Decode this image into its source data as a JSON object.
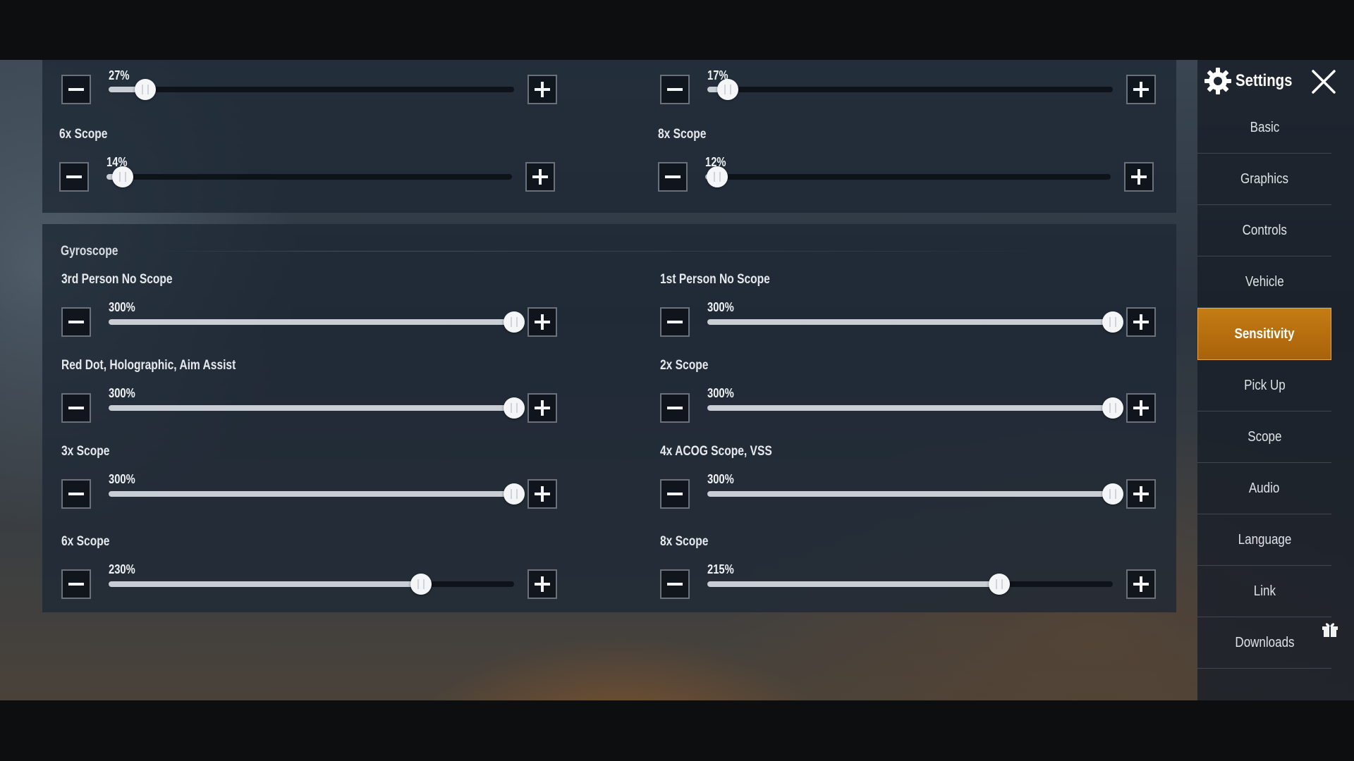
{
  "sidebar": {
    "title": "Settings",
    "items": [
      {
        "label": "Basic",
        "active": false
      },
      {
        "label": "Graphics",
        "active": false
      },
      {
        "label": "Controls",
        "active": false
      },
      {
        "label": "Vehicle",
        "active": false
      },
      {
        "label": "Sensitivity",
        "active": true
      },
      {
        "label": "Pick Up",
        "active": false
      },
      {
        "label": "Scope",
        "active": false
      },
      {
        "label": "Audio",
        "active": false
      },
      {
        "label": "Language",
        "active": false
      },
      {
        "label": "Link",
        "active": false
      },
      {
        "label": "Downloads",
        "active": false
      }
    ]
  },
  "camera": {
    "settings": [
      {
        "label": "",
        "value_text": "27%",
        "fraction": 0.09
      },
      {
        "label": "",
        "value_text": "17%",
        "fraction": 0.05
      },
      {
        "label": "6x Scope",
        "value_text": "14%",
        "fraction": 0.04
      },
      {
        "label": "8x Scope",
        "value_text": "12%",
        "fraction": 0.03
      }
    ]
  },
  "gyroscope": {
    "title": "Gyroscope",
    "settings": [
      {
        "label": "3rd Person No Scope",
        "value_text": "300%",
        "fraction": 1.0
      },
      {
        "label": "1st Person No Scope",
        "value_text": "300%",
        "fraction": 1.0
      },
      {
        "label": "Red Dot, Holographic, Aim Assist",
        "value_text": "300%",
        "fraction": 1.0
      },
      {
        "label": "2x Scope",
        "value_text": "300%",
        "fraction": 1.0
      },
      {
        "label": "3x Scope",
        "value_text": "300%",
        "fraction": 1.0
      },
      {
        "label": "4x ACOG Scope, VSS",
        "value_text": "300%",
        "fraction": 1.0
      },
      {
        "label": "6x Scope",
        "value_text": "230%",
        "fraction": 0.77
      },
      {
        "label": "8x Scope",
        "value_text": "215%",
        "fraction": 0.72
      }
    ]
  },
  "icons": {
    "settings_icon": "gear-icon",
    "close_icon": "close-icon",
    "minus_icon": "minus-icon",
    "plus_icon": "plus-icon",
    "downloads_badge": "gift-icon"
  },
  "colors": {
    "accent": "#b86d10",
    "panel": "#1e2834",
    "slider_fill": "#c9ced4"
  }
}
